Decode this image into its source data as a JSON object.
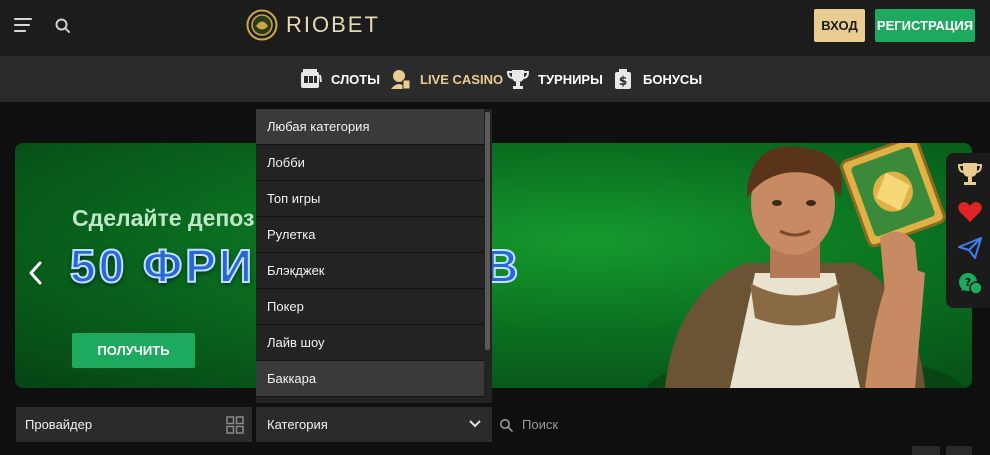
{
  "header": {
    "logo_text": "RIOBET",
    "login_label": "ВХОД",
    "register_label": "РЕГИСТРАЦИЯ"
  },
  "nav": {
    "items": [
      {
        "label": "СЛОТЫ",
        "icon": "slot-machine-icon"
      },
      {
        "label": "LIVE CASINO",
        "icon": "dealer-icon",
        "active": true
      },
      {
        "label": "ТУРНИРЫ",
        "icon": "trophy-icon"
      },
      {
        "label": "БОНУСЫ",
        "icon": "bonus-icon"
      }
    ]
  },
  "banner": {
    "subtitle": "Сделайте депозит и",
    "headline": "50 ФРИ",
    "headline_tail": "В",
    "cta_label": "ПОЛУЧИТЬ"
  },
  "side_rail": {
    "icons": [
      "trophy-icon",
      "heart-icon",
      "send-icon",
      "support-chat-icon"
    ]
  },
  "category_dropdown": {
    "options": [
      "Любая категория",
      "Лобби",
      "Топ игры",
      "Рулетка",
      "Блэкджек",
      "Покер",
      "Лайв шоу",
      "Баккара"
    ]
  },
  "filters": {
    "provider_label": "Провайдер",
    "category_label": "Категория",
    "search_placeholder": "Поиск"
  },
  "colors": {
    "accent_gold": "#e8cc92",
    "accent_green": "#1daa5f",
    "header_bg": "#1c1c1c",
    "nav_bg": "#2b2b2b"
  }
}
